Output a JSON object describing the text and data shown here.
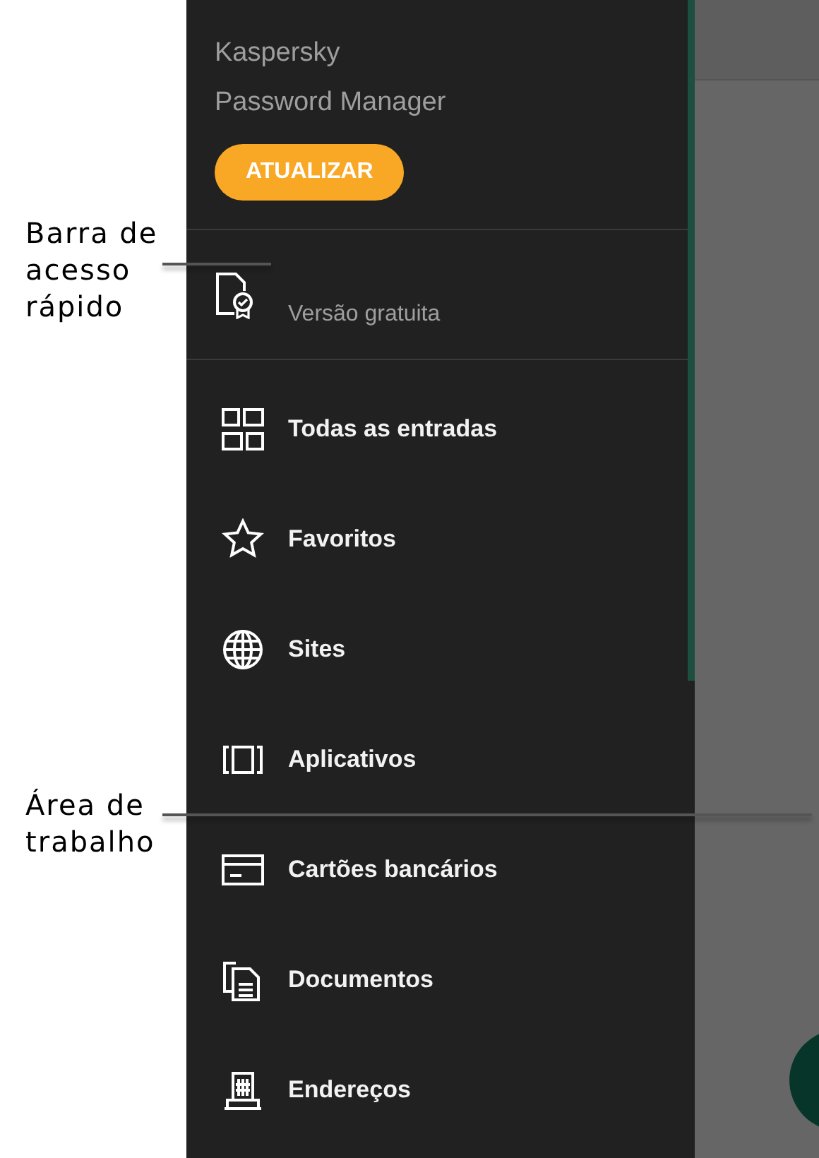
{
  "drawer": {
    "app_name": [
      "Kaspersky",
      "Password Manager"
    ],
    "upgrade_button": "ATUALIZAR",
    "quick_access": {
      "label": "Versão gratuita"
    },
    "menu": [
      {
        "label": "Todas as entradas"
      },
      {
        "label": "Favoritos"
      },
      {
        "label": "Sites"
      },
      {
        "label": "Aplicativos"
      },
      {
        "label": "Cartões bancários"
      },
      {
        "label": "Documentos"
      },
      {
        "label": "Endereços"
      }
    ]
  },
  "annotations": [
    {
      "label": "Barra de acesso rápido"
    },
    {
      "label": "Área de trabalho"
    }
  ]
}
